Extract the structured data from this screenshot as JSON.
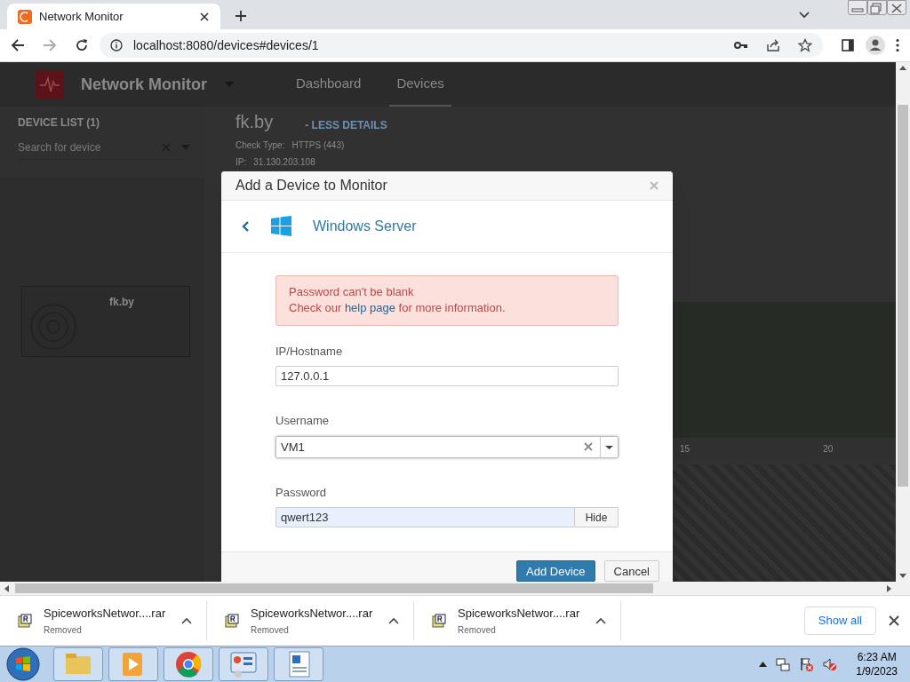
{
  "browser": {
    "tab_title": "Network Monitor",
    "url": "localhost:8080/devices#devices/1"
  },
  "app": {
    "brand": "Network Monitor",
    "nav_tabs": [
      {
        "label": "Dashboard",
        "selected": false
      },
      {
        "label": "Devices",
        "selected": true
      }
    ],
    "sidebar": {
      "heading": "DEVICE LIST (1)",
      "search_placeholder": "Search for device",
      "devices": [
        {
          "name": "fk.by"
        }
      ]
    },
    "detail": {
      "title": "fk.by",
      "toggle": "- LESS DETAILS",
      "fields": [
        {
          "label": "Check Type:",
          "value": "HTTPS (443)"
        },
        {
          "label": "IP:",
          "value": "31.130.203.108"
        }
      ]
    },
    "axis_labels": [
      "15",
      "20"
    ]
  },
  "modal": {
    "title": "Add a Device to Monitor",
    "device_type": "Windows Server",
    "alert": {
      "message": "Password can't be blank",
      "prefix": "Check our",
      "link": "help page",
      "suffix": "for more information."
    },
    "fields": [
      {
        "label": "IP/Hostname",
        "value": "127.0.0.1",
        "kind": "text"
      },
      {
        "label": "Username",
        "value": "VM1",
        "kind": "combo"
      },
      {
        "label": "Password",
        "value": "qwert123",
        "kind": "password",
        "action": "Hide"
      }
    ],
    "buttons": [
      {
        "label": "Add Device",
        "kind": "primary"
      },
      {
        "label": "Cancel",
        "kind": "default"
      }
    ]
  },
  "downloads": {
    "items": [
      {
        "name": "SpiceworksNetwor....rar",
        "status": "Removed"
      },
      {
        "name": "SpiceworksNetwor....rar",
        "status": "Removed"
      },
      {
        "name": "SpiceworksNetwor....rar",
        "status": "Removed"
      }
    ],
    "show_all": "Show all"
  },
  "taskbar": {
    "time": "6:23 AM",
    "date": "1/9/2023"
  }
}
